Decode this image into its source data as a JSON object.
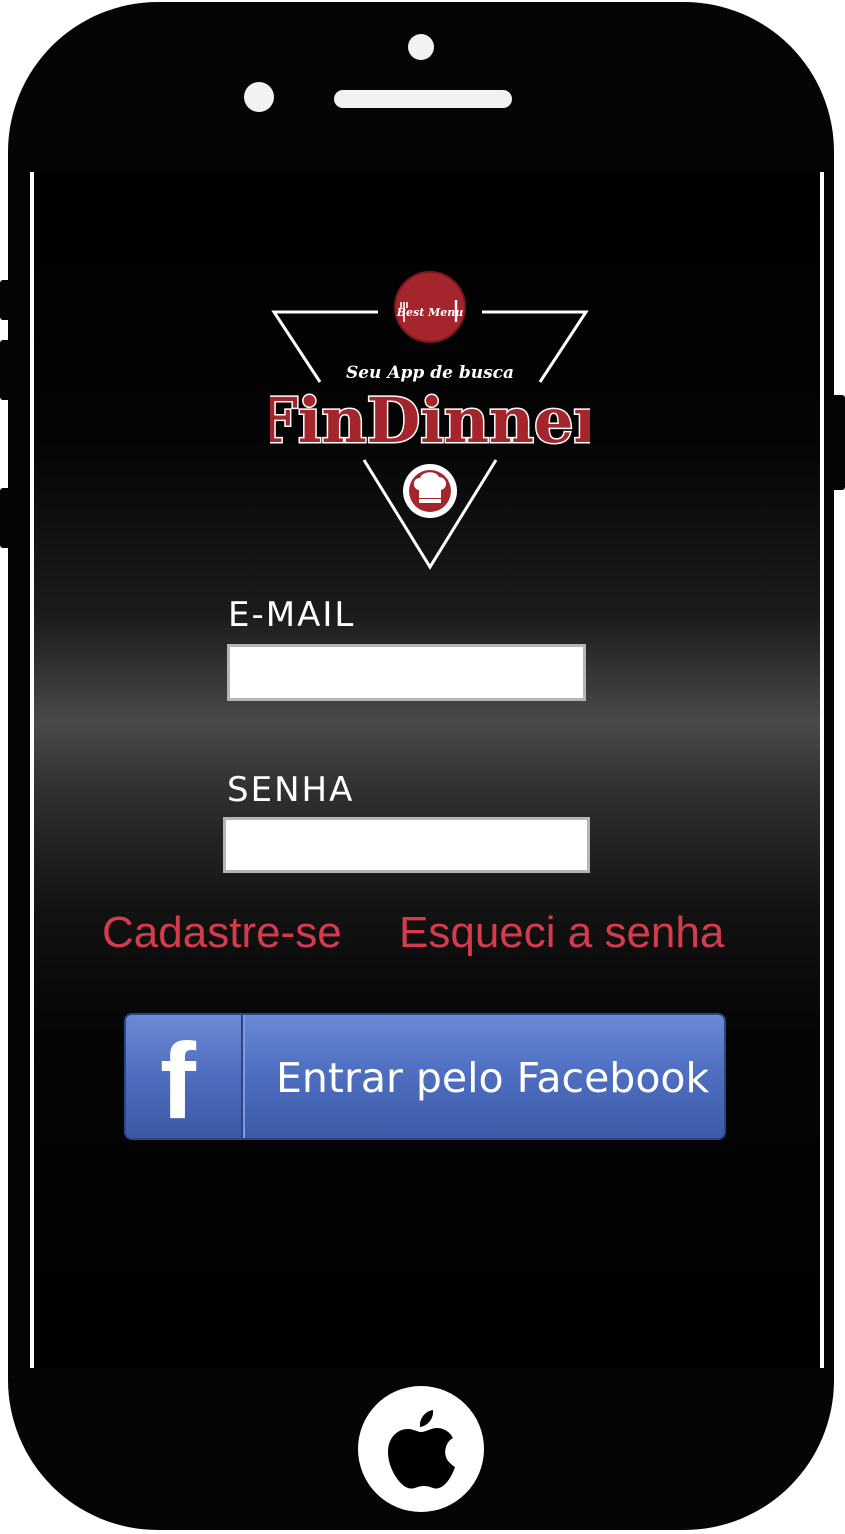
{
  "logo": {
    "badge_text": "Best Menu",
    "tagline": "Seu App de busca",
    "brand": "FinDinner"
  },
  "email": {
    "label": "E-MAIL",
    "value": "",
    "placeholder": ""
  },
  "password": {
    "label": "SENHA",
    "value": "",
    "placeholder": ""
  },
  "links": {
    "signup": "Cadastre-se",
    "forgot": "Esqueci a senha"
  },
  "facebook": {
    "icon_letter": "f",
    "label": "Entrar pelo Facebook"
  },
  "colors": {
    "accent_red": "#d43b4c",
    "brand_red": "#a4252c",
    "facebook_blue": "#4f6fc2"
  }
}
